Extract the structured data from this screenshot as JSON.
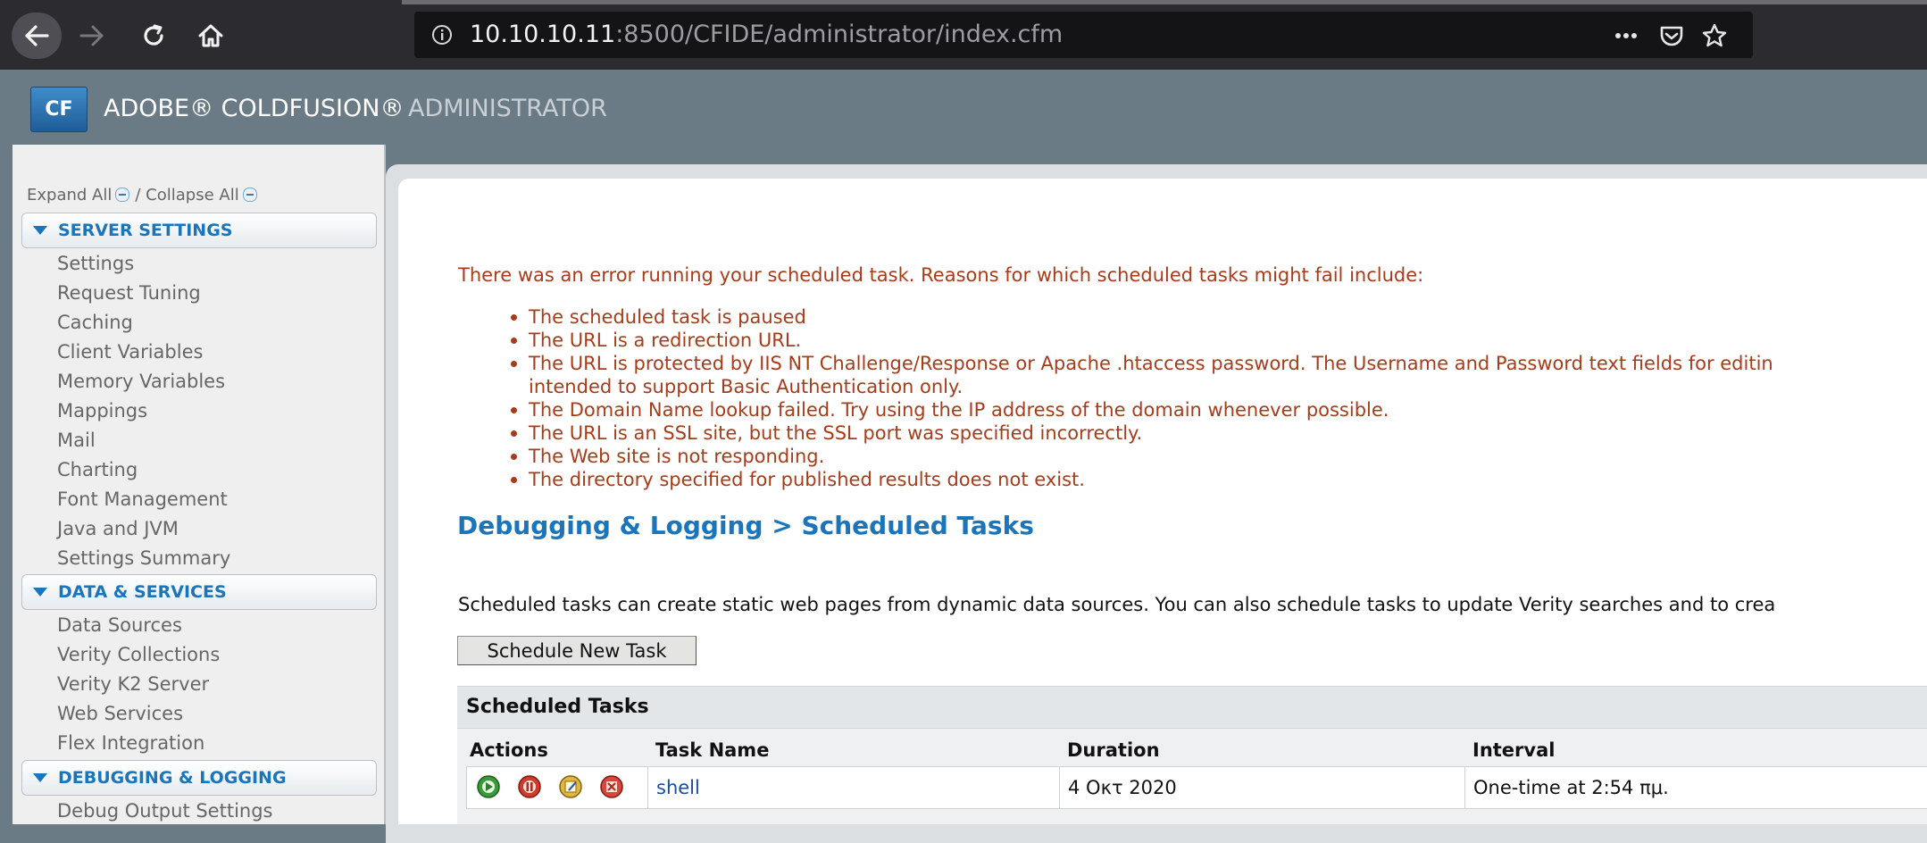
{
  "browser": {
    "url_host": "10.10.10.11",
    "url_rest": ":8500/CFIDE/administrator/index.cfm"
  },
  "header": {
    "logo_text": "CF",
    "product": "ADOBE® COLDFUSION®",
    "subtitle": "ADMINISTRATOR"
  },
  "sidebar": {
    "expand_all": "Expand All",
    "separator": "/",
    "collapse_all": "Collapse All",
    "sections": [
      {
        "label": "SERVER SETTINGS",
        "items": [
          "Settings",
          "Request Tuning",
          "Caching",
          "Client Variables",
          "Memory Variables",
          "Mappings",
          "Mail",
          "Charting",
          "Font Management",
          "Java and JVM",
          "Settings Summary"
        ]
      },
      {
        "label": "DATA & SERVICES",
        "items": [
          "Data Sources",
          "Verity Collections",
          "Verity K2 Server",
          "Web Services",
          "Flex Integration"
        ]
      },
      {
        "label": "DEBUGGING & LOGGING",
        "items": [
          "Debug Output Settings"
        ]
      }
    ]
  },
  "main": {
    "error_intro": "There was an error running your scheduled task. Reasons for which scheduled tasks might fail include:",
    "error_reasons": [
      "The scheduled task is paused",
      "The URL is a redirection URL.",
      "The URL is protected by IIS NT Challenge/Response or Apache .htaccess password. The Username and Password text fields for editin",
      "intended to support Basic Authentication only.",
      "The Domain Name lookup failed. Try using the IP address of the domain whenever possible.",
      "The URL is an SSL site, but the SSL port was specified incorrectly.",
      "The Web site is not responding.",
      "The directory specified for published results does not exist."
    ],
    "breadcrumb": "Debugging & Logging > Scheduled Tasks",
    "description": "Scheduled tasks can create static web pages from dynamic data sources. You can also schedule tasks to update Verity searches and to crea",
    "new_task_button": "Schedule New Task",
    "tasks_title": "Scheduled Tasks",
    "columns": [
      "Actions",
      "Task Name",
      "Duration",
      "Interval"
    ],
    "rows": [
      {
        "task_name": "shell",
        "duration": "4 Οκτ 2020",
        "interval": "One-time at 2:54 πμ."
      }
    ]
  },
  "colors": {
    "accent": "#1a75bb",
    "error": "#a83c1a",
    "header_bg": "#6b7b86"
  }
}
